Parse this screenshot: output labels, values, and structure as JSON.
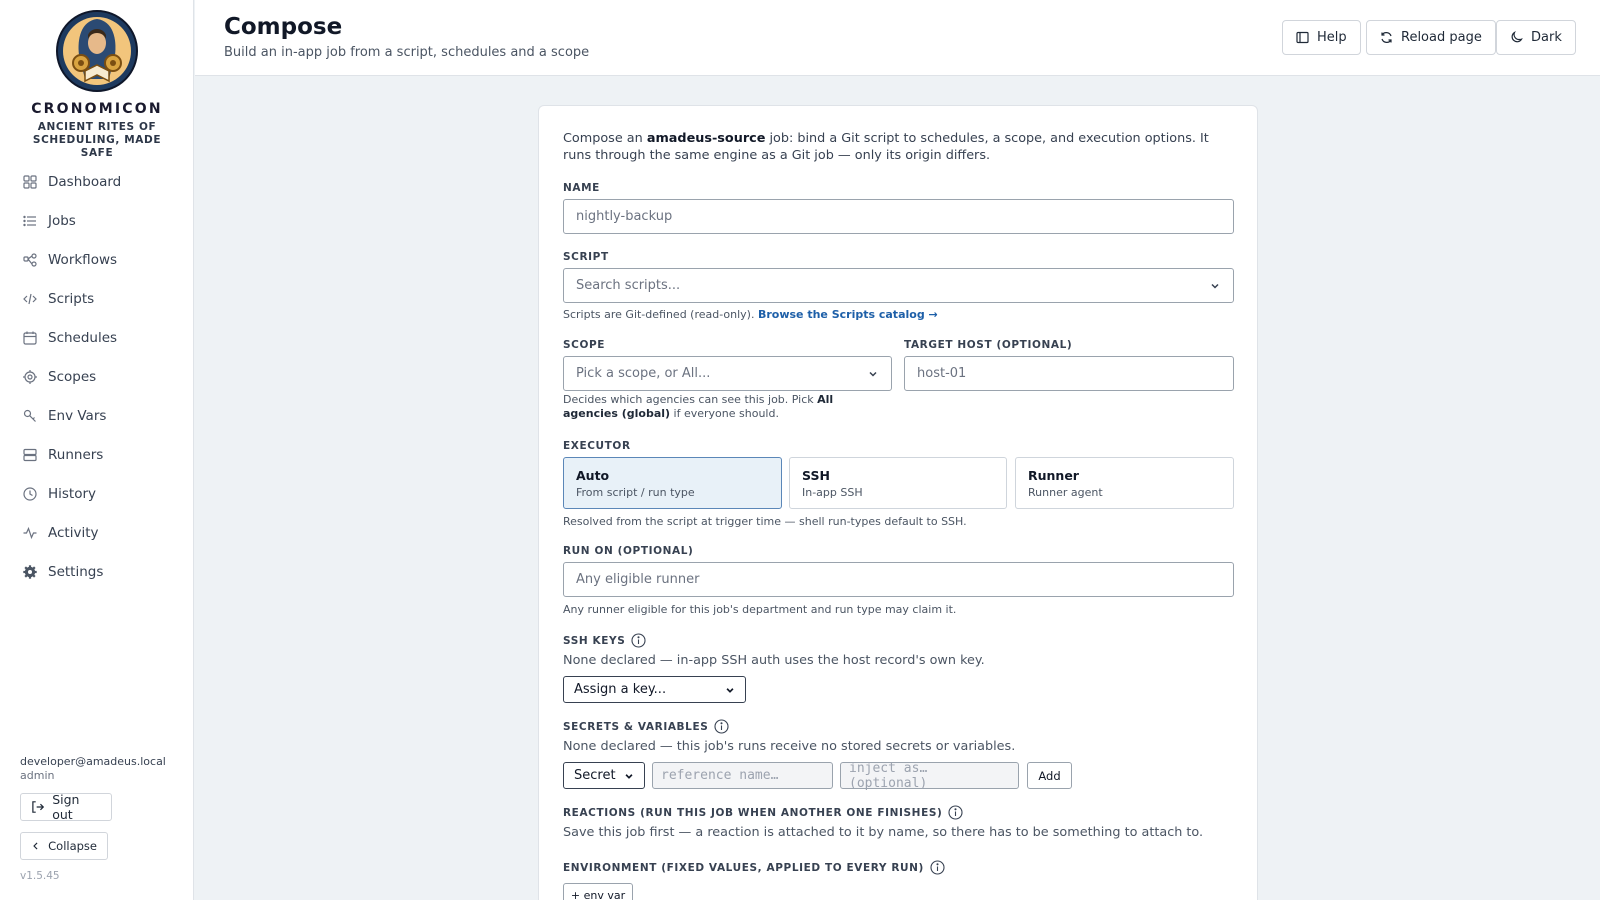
{
  "brand": {
    "name": "CRONOMICON",
    "tagline": "ANCIENT RITES OF SCHEDULING, MADE SAFE"
  },
  "sidebar": {
    "items": [
      {
        "label": "Dashboard",
        "icon": "grid-icon"
      },
      {
        "label": "Jobs",
        "icon": "list-icon"
      },
      {
        "label": "Workflows",
        "icon": "workflow-icon"
      },
      {
        "label": "Scripts",
        "icon": "code-icon"
      },
      {
        "label": "Schedules",
        "icon": "calendar-icon"
      },
      {
        "label": "Scopes",
        "icon": "target-icon"
      },
      {
        "label": "Env Vars",
        "icon": "key-icon"
      },
      {
        "label": "Runners",
        "icon": "server-icon"
      },
      {
        "label": "History",
        "icon": "clock-icon"
      },
      {
        "label": "Activity",
        "icon": "activity-icon"
      },
      {
        "label": "Settings",
        "icon": "gear-icon"
      }
    ],
    "user_email": "developer@amadeus.local",
    "user_role": "admin",
    "sign_out_label": "Sign out",
    "collapse_label": "Collapse",
    "version": "v1.5.45"
  },
  "header": {
    "title": "Compose",
    "subtitle": "Build an in-app job from a script, schedules and a scope",
    "help_label": "Help",
    "reload_label": "Reload page",
    "theme_label": "Dark"
  },
  "form": {
    "intro_prefix": "Compose an ",
    "intro_bold": "amadeus-source",
    "intro_suffix": " job: bind a Git script to schedules, a scope, and execution options. It runs through the same engine as a Git job — only its origin differs.",
    "name": {
      "label": "NAME",
      "placeholder": "nightly-backup"
    },
    "script": {
      "label": "SCRIPT",
      "placeholder": "Search scripts...",
      "hint_prefix": "Scripts are Git-defined (read-only). ",
      "hint_link": "Browse the Scripts catalog →"
    },
    "scope": {
      "label": "SCOPE",
      "placeholder": "Pick a scope, or All...",
      "hint_prefix": "Decides which agencies can see this job. Pick ",
      "hint_bold": "All agencies (global)",
      "hint_suffix": " if everyone should."
    },
    "target_host": {
      "label": "TARGET HOST (OPTIONAL)",
      "placeholder": "host-01"
    },
    "executor": {
      "label": "EXECUTOR",
      "options": [
        {
          "title": "Auto",
          "desc": "From script / run type"
        },
        {
          "title": "SSH",
          "desc": "In-app SSH"
        },
        {
          "title": "Runner",
          "desc": "Runner agent"
        }
      ],
      "selected": "Auto",
      "hint": "Resolved from the script at trigger time — shell run-types default to SSH."
    },
    "run_on": {
      "label": "RUN ON (OPTIONAL)",
      "placeholder": "Any eligible runner",
      "hint": "Any runner eligible for this job's department and run type may claim it."
    },
    "ssh_keys": {
      "label": "SSH KEYS",
      "text": "None declared — in-app SSH auth uses the host record's own key.",
      "select_value": "Assign a key..."
    },
    "secrets": {
      "label": "SECRETS & VARIABLES",
      "text": "None declared — this job's runs receive no stored secrets or variables.",
      "type_value": "Secret",
      "ref_placeholder": "reference name…",
      "inject_placeholder": "inject as… (optional)",
      "add_label": "Add"
    },
    "reactions": {
      "label": "REACTIONS (RUN THIS JOB WHEN ANOTHER ONE FINISHES)",
      "text": "Save this job first — a reaction is attached to it by name, so there has to be something to attach to."
    },
    "environment": {
      "label": "ENVIRONMENT (FIXED VALUES, APPLIED TO EVERY RUN)",
      "add_label": "+ env var"
    }
  },
  "colors": {
    "accent": "#1d5fa8",
    "selected_bg": "#e8f1f8",
    "page_bg": "#eef2f5"
  }
}
